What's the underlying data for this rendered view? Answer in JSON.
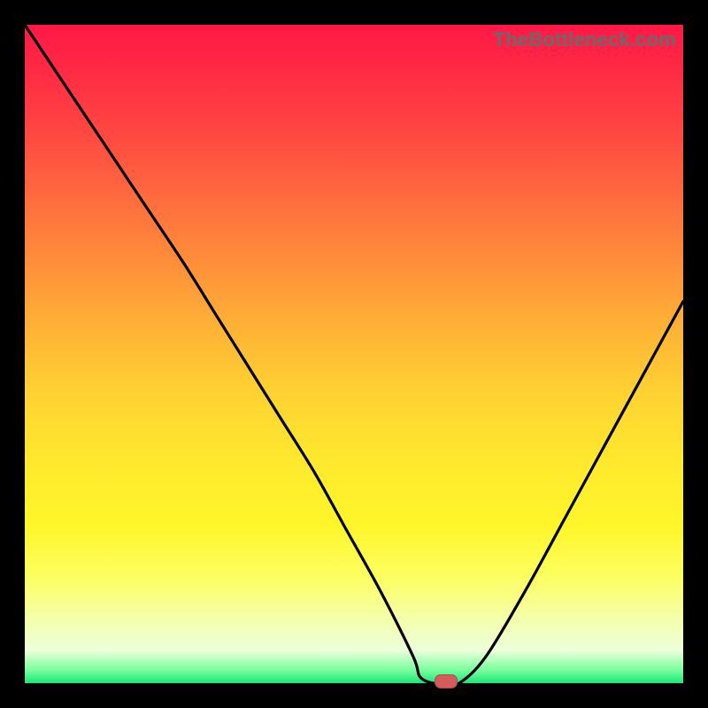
{
  "watermark": "TheBottleneck.com",
  "colors": {
    "frame": "#000000",
    "curve": "#000000",
    "marker_fill": "#d35d5d",
    "marker_border": "#a84848",
    "gradient_top": "#ff1846",
    "gradient_bottom": "#1de37a"
  },
  "chart_data": {
    "type": "line",
    "title": "",
    "xlabel": "",
    "ylabel": "",
    "xlim": [
      0,
      100
    ],
    "ylim": [
      0,
      100
    ],
    "series": [
      {
        "name": "bottleneck-curve",
        "x": [
          0,
          6,
          12,
          18,
          24,
          29,
          34,
          39,
          44,
          49,
          54,
          59,
          60,
          62,
          64,
          66,
          70,
          76,
          82,
          88,
          94,
          100
        ],
        "values": [
          100,
          91,
          82,
          73,
          64,
          56,
          48,
          40,
          32,
          23,
          14,
          4,
          1,
          0,
          0,
          0,
          4,
          14,
          25,
          36,
          47,
          58
        ]
      }
    ],
    "annotations": [
      {
        "name": "optimal-marker",
        "x": 64,
        "y": 0
      }
    ]
  }
}
